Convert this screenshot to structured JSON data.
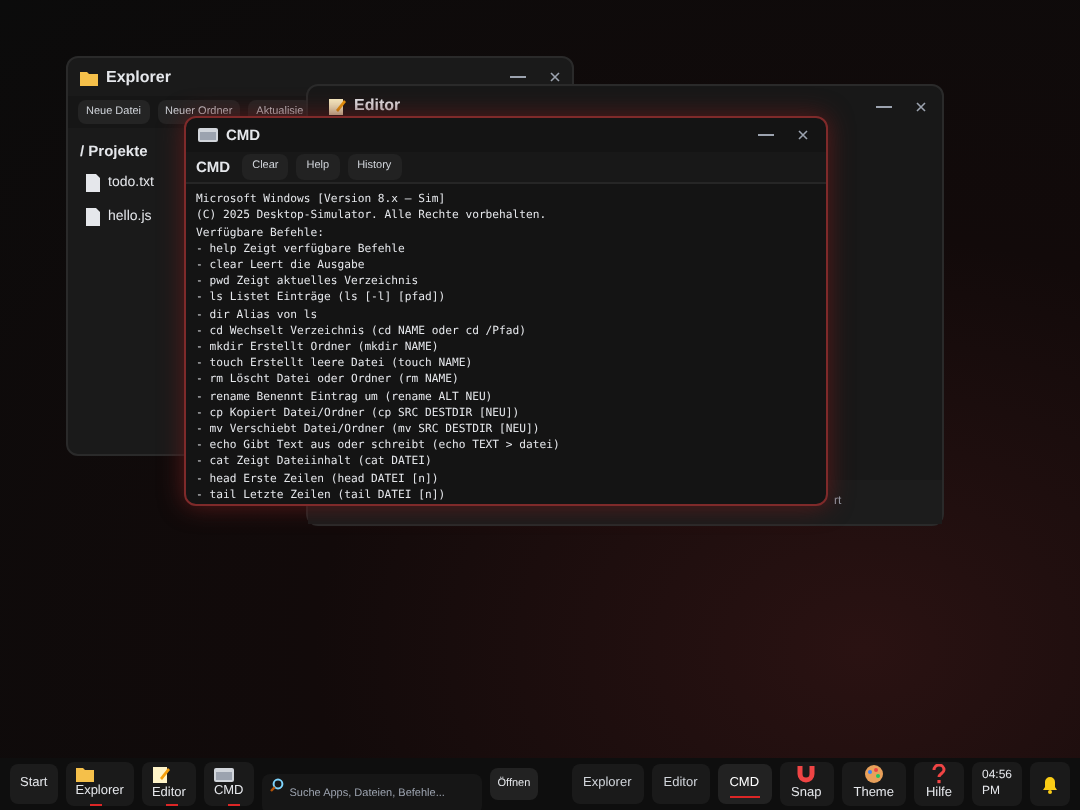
{
  "explorer": {
    "title": "Explorer",
    "toolbar": [
      "Neue Datei",
      "Neuer Ordner",
      "Aktualisie"
    ],
    "path": "/ Projekte",
    "files": [
      "todo.txt",
      "hello.js"
    ]
  },
  "editor": {
    "title": "Editor",
    "status_text": "rt"
  },
  "cmd": {
    "title": "CMD",
    "label": "CMD",
    "buttons": [
      "Clear",
      "Help",
      "History"
    ],
    "lines": [
      "Microsoft Windows [Version 8.x – Sim]",
      "(C) 2025 Desktop-Simulator. Alle Rechte vorbehalten.",
      "Verfügbare Befehle:",
      "- help Zeigt verfügbare Befehle",
      "- clear Leert die Ausgabe",
      "- pwd Zeigt aktuelles Verzeichnis",
      "- ls Listet Einträge (ls [-l] [pfad])",
      "- dir Alias von ls",
      "- cd Wechselt Verzeichnis (cd NAME oder cd /Pfad)",
      "- mkdir Erstellt Ordner (mkdir NAME)",
      "- touch Erstellt leere Datei (touch NAME)",
      "- rm Löscht Datei oder Ordner (rm NAME)",
      "- rename Benennt Eintrag um (rename ALT NEU)",
      "- cp Kopiert Datei/Ordner (cp SRC DESTDIR [NEU])",
      "- mv Verschiebt Datei/Ordner (mv SRC DESTDIR [NEU])",
      "- echo Gibt Text aus oder schreibt (echo TEXT > datei)",
      "- cat Zeigt Dateiinhalt (cat DATEI)",
      "- head Erste Zeilen (head DATEI [n])",
      "- tail Letzte Zeilen (tail DATEI [n])"
    ]
  },
  "taskbar": {
    "start": "Start",
    "launchers": [
      {
        "kind": "folder",
        "label": "Explorer",
        "running": true
      },
      {
        "kind": "notepad",
        "label": "Editor",
        "running": true
      },
      {
        "kind": "terminal",
        "label": "CMD",
        "running": true
      }
    ],
    "search": {
      "placeholder": "Suche Apps, Dateien, Befehle..."
    },
    "open_button": "Öffnen",
    "windows": [
      {
        "label": "Explorer",
        "selected": false
      },
      {
        "label": "Editor",
        "selected": false
      },
      {
        "label": "CMD",
        "selected": true
      }
    ],
    "tools": [
      {
        "kind": "magnet",
        "label": "Snap"
      },
      {
        "kind": "palette",
        "label": "Theme"
      },
      {
        "kind": "help",
        "label": "Hilfe"
      }
    ],
    "clock": {
      "time": "04:56",
      "period": "PM"
    }
  }
}
